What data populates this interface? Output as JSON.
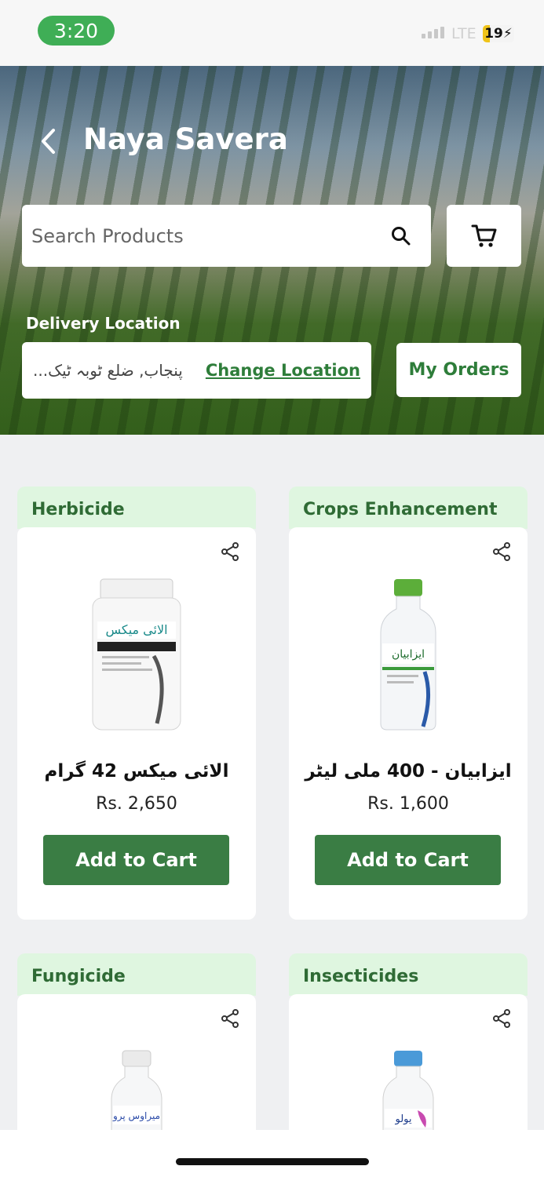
{
  "status_bar": {
    "time": "3:20",
    "network": "LTE",
    "battery": "19"
  },
  "header": {
    "title": "Naya Savera"
  },
  "search": {
    "placeholder": "Search Products"
  },
  "delivery": {
    "label": "Delivery Location",
    "location": "پنجاب, ضلع ٹوبہ ٹیک...",
    "change_label": "Change Location"
  },
  "orders": {
    "label": "My Orders"
  },
  "products": [
    {
      "category": "Herbicide",
      "name": "الائی میکس 42 گرام",
      "price": "Rs. 2,650",
      "button": "Add to Cart"
    },
    {
      "category": "Crops Enhancement",
      "name": "ایزابیان - 400 ملی لیٹر",
      "price": "Rs. 1,600",
      "button": "Add to Cart"
    },
    {
      "category": "Fungicide"
    },
    {
      "category": "Insecticides"
    }
  ],
  "colors": {
    "accent": "#3a7d44",
    "category_bg": "#dff6e0",
    "time_pill": "#3fae56"
  }
}
